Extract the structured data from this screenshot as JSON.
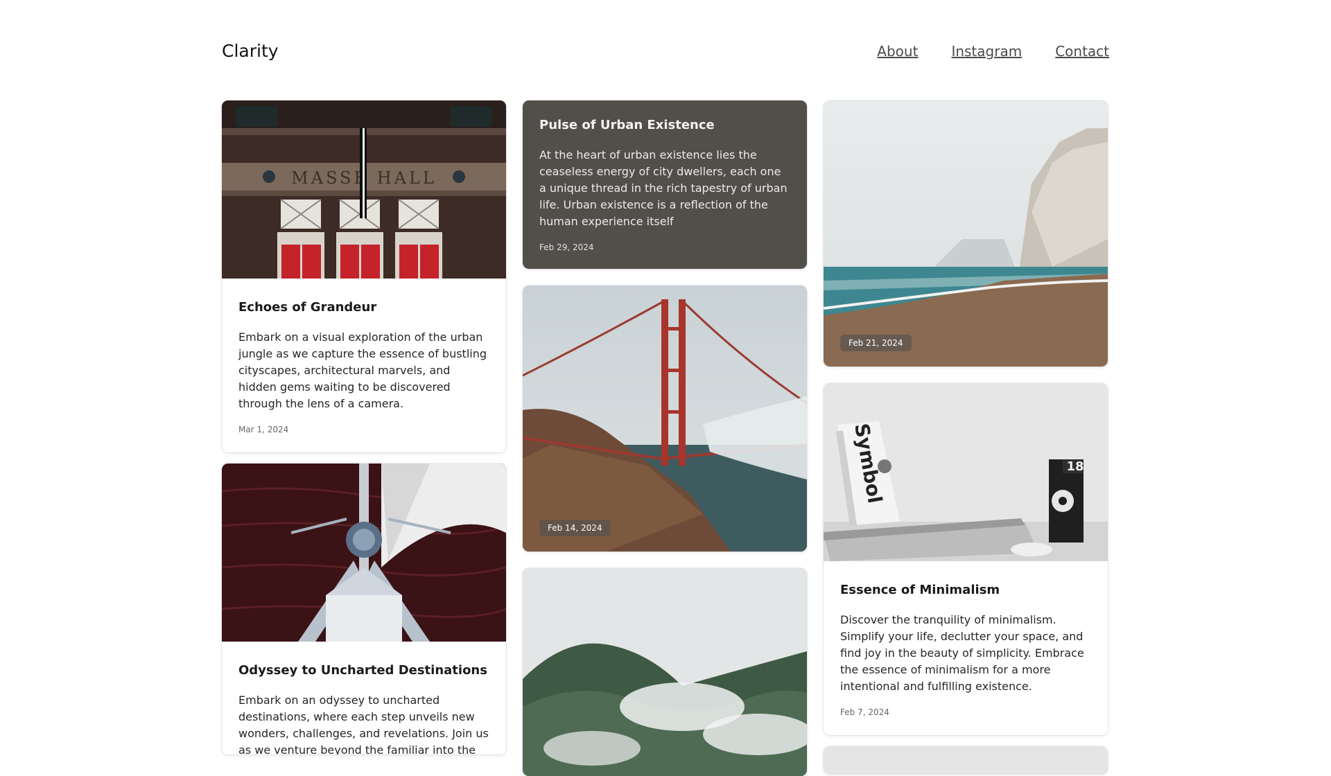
{
  "header": {
    "logo": "Clarity",
    "nav": [
      "About",
      "Instagram",
      "Contact"
    ]
  },
  "cards": {
    "echoes": {
      "title": "Echoes of Grandeur",
      "text": "Embark on a visual exploration of the urban jungle as we capture the essence of bustling cityscapes, architectural marvels, and hidden gems waiting to be discovered through the lens of a camera.",
      "date": "Mar 1, 2024",
      "image_sign": "MASSE  HALL"
    },
    "odyssey": {
      "title": "Odyssey to Uncharted Destinations",
      "text": "Embark on an odyssey to uncharted destinations, where each step unveils new wonders, challenges, and revelations. Join us as we venture beyond the familiar into the realm of"
    },
    "pulse": {
      "title": "Pulse of Urban Existence",
      "text": "At the heart of urban existence lies the ceaseless energy of city dwellers, each one a unique thread in the rich tapestry of urban life. Urban existence is a reflection of the human experience itself",
      "date": "Feb 29, 2024"
    },
    "bridge": {
      "date": "Feb 14, 2024"
    },
    "cliffs": {
      "date": "Feb 21, 2024"
    },
    "minimal": {
      "title": "Essence of Minimalism",
      "text": "Discover the tranquility of minimalism. Simplify your life, declutter your space, and find joy in the beauty of simplicity. Embrace the essence of minimalism for a more intentional and fulfilling existence.",
      "date": "Feb 7, 2024",
      "book_label": "Symbol",
      "calendar_number": "18"
    }
  },
  "colors": {
    "dark_card": "#524e4a",
    "link": "#4a4a4a",
    "door_red": "#c4232a"
  }
}
